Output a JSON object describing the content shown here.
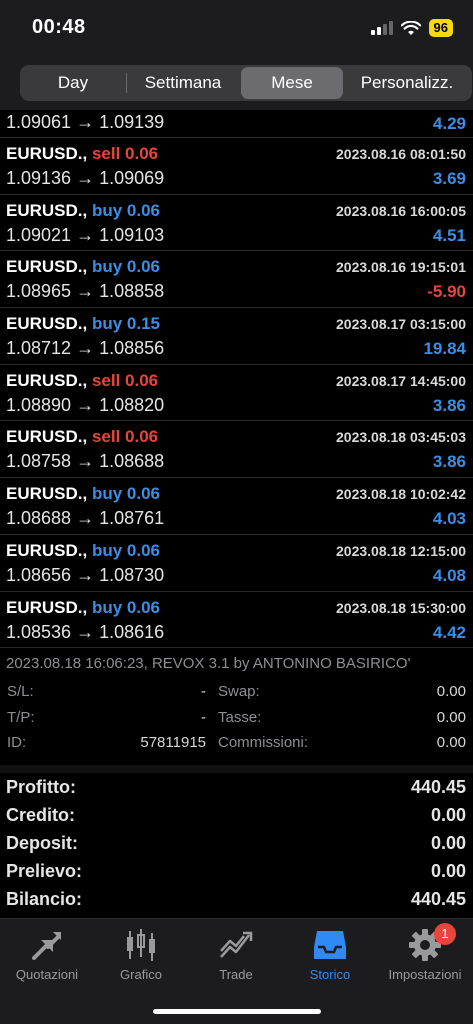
{
  "status_bar": {
    "time": "00:48",
    "battery": "96"
  },
  "periods": [
    "Day",
    "Settimana",
    "Mese",
    "Personalizz."
  ],
  "selected_period": "Mese",
  "first_row": {
    "prices": "1.09061 → 1.09139",
    "profit": "4.29"
  },
  "deals": [
    {
      "symbol": "EURUSD.,",
      "type": "sell 0.06",
      "direction": "sell",
      "datetime": "2023.08.16 08:01:50",
      "prices": "1.09136 → 1.09069",
      "profit": "3.69"
    },
    {
      "symbol": "EURUSD.,",
      "type": "buy 0.06",
      "direction": "buy",
      "datetime": "2023.08.16 16:00:05",
      "prices": "1.09021 → 1.09103",
      "profit": "4.51"
    },
    {
      "symbol": "EURUSD.,",
      "type": "buy 0.06",
      "direction": "buy",
      "datetime": "2023.08.16 19:15:01",
      "prices": "1.08965 → 1.08858",
      "profit": "-5.90"
    },
    {
      "symbol": "EURUSD.,",
      "type": "buy 0.15",
      "direction": "buy",
      "datetime": "2023.08.17 03:15:00",
      "prices": "1.08712 → 1.08856",
      "profit": "19.84"
    },
    {
      "symbol": "EURUSD.,",
      "type": "sell 0.06",
      "direction": "sell",
      "datetime": "2023.08.17 14:45:00",
      "prices": "1.08890 → 1.08820",
      "profit": "3.86"
    },
    {
      "symbol": "EURUSD.,",
      "type": "sell 0.06",
      "direction": "sell",
      "datetime": "2023.08.18 03:45:03",
      "prices": "1.08758 → 1.08688",
      "profit": "3.86"
    },
    {
      "symbol": "EURUSD.,",
      "type": "buy 0.06",
      "direction": "buy",
      "datetime": "2023.08.18 10:02:42",
      "prices": "1.08688 → 1.08761",
      "profit": "4.03"
    },
    {
      "symbol": "EURUSD.,",
      "type": "buy 0.06",
      "direction": "buy",
      "datetime": "2023.08.18 12:15:00",
      "prices": "1.08656 → 1.08730",
      "profit": "4.08"
    },
    {
      "symbol": "EURUSD.,",
      "type": "buy 0.06",
      "direction": "buy",
      "datetime": "2023.08.18 15:30:00",
      "prices": "1.08536 → 1.08616",
      "profit": "4.42"
    }
  ],
  "details": {
    "comment": "2023.08.18 16:06:23, REVOX 3.1 by ANTONINO BASIRICO'",
    "sl_label": "S/L:",
    "sl_value": "-",
    "tp_label": "T/P:",
    "tp_value": "-",
    "id_label": "ID:",
    "id_value": "57811915",
    "swap_label": "Swap:",
    "swap_value": "0.00",
    "tax_label": "Tasse:",
    "tax_value": "0.00",
    "comm_label": "Commissioni:",
    "comm_value": "0.00"
  },
  "summary": [
    {
      "label": "Profitto:",
      "value": "440.45"
    },
    {
      "label": "Credito:",
      "value": "0.00"
    },
    {
      "label": "Deposit:",
      "value": "0.00"
    },
    {
      "label": "Prelievo:",
      "value": "0.00"
    },
    {
      "label": "Bilancio:",
      "value": "440.45"
    }
  ],
  "tabs": [
    {
      "label": "Quotazioni",
      "icon": "quotes-arrows-icon"
    },
    {
      "label": "Grafico",
      "icon": "candlestick-icon"
    },
    {
      "label": "Trade",
      "icon": "trade-chart-icon"
    },
    {
      "label": "Storico",
      "icon": "history-tray-icon",
      "active": true
    },
    {
      "label": "Impostazioni",
      "icon": "gear-icon",
      "badge": "1"
    }
  ],
  "colors": {
    "buy": "#3a8ee6",
    "sell": "#e8453c",
    "active_tab": "#2f8af5"
  }
}
